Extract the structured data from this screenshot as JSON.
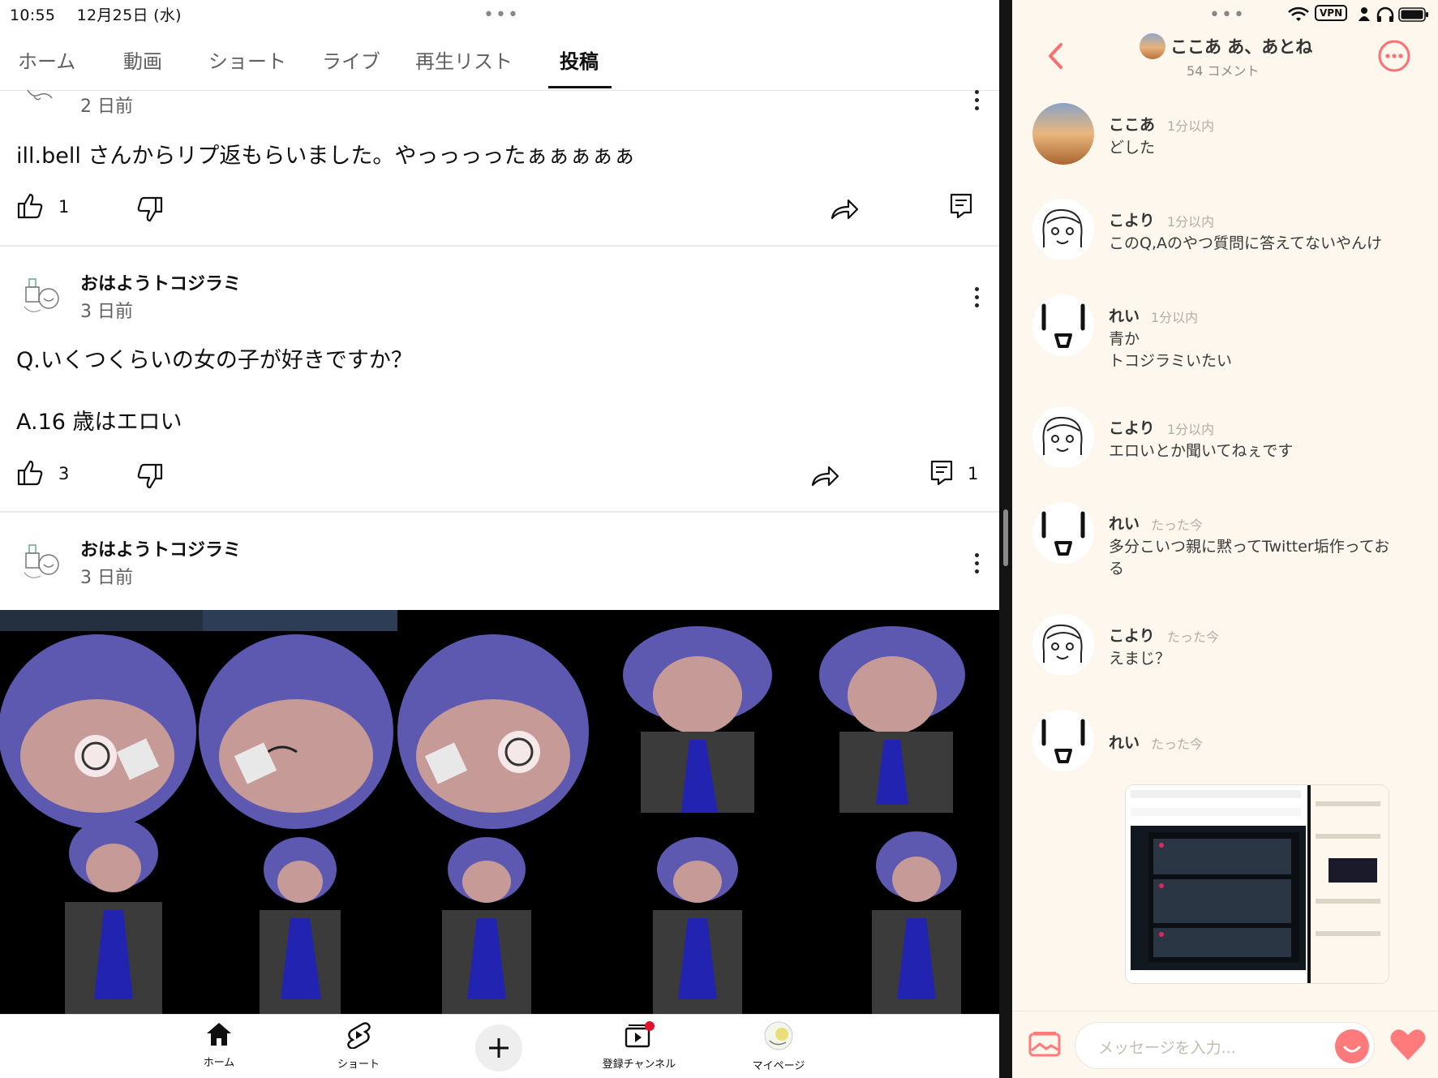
{
  "status_bar": {
    "time": "10:55",
    "date": "12月25日 (水)",
    "vpn": "VPN"
  },
  "youtube": {
    "tabs": [
      {
        "label": "ホーム"
      },
      {
        "label": "動画"
      },
      {
        "label": "ショート"
      },
      {
        "label": "ライブ"
      },
      {
        "label": "再生リスト"
      },
      {
        "label": "投稿",
        "active": true
      }
    ],
    "posts": [
      {
        "date": "2 日前",
        "text": "ill.bell さんからリプ返もらいました。やっっっったぁぁぁぁぁ",
        "likes": "1"
      },
      {
        "author": "おはようトコジラミ",
        "date": "3 日前",
        "text_lines": [
          "Q.いくつくらいの女の子が好きですか？",
          "A.16 歳はエロい"
        ],
        "likes": "3",
        "comments": "1"
      },
      {
        "author": "おはようトコジラミ",
        "date": "3 日前"
      }
    ],
    "bottom_nav": [
      {
        "label": "ホーム",
        "icon": "home-icon"
      },
      {
        "label": "ショート",
        "icon": "shorts-icon"
      },
      {
        "label": "",
        "icon": "plus-icon"
      },
      {
        "label": "登録チャンネル",
        "icon": "subscriptions-icon"
      },
      {
        "label": "マイページ",
        "icon": "avatar-icon"
      }
    ]
  },
  "chat": {
    "title": "ここあ あ、あとね",
    "subtitle": "54 コメント",
    "messages": [
      {
        "name": "ここあ",
        "time": "1分以内",
        "text": "どした",
        "avatar": "sunset-avatar"
      },
      {
        "name": "こより",
        "time": "1分以内",
        "text": "このQ,Aのやつ質問に答えてないやんけ",
        "avatar": "sketch-face-avatar"
      },
      {
        "name": "れい",
        "time": "1分以内",
        "text": "青か\nトコジラミいたい",
        "avatar": "simple-face-avatar"
      },
      {
        "name": "こより",
        "time": "1分以内",
        "text": "エロいとか聞いてねぇです",
        "avatar": "sketch-face-avatar"
      },
      {
        "name": "れい",
        "time": "たった今",
        "text": "多分こいつ親に黙ってTwitter垢作ってお\nる",
        "avatar": "simple-face-avatar"
      },
      {
        "name": "こより",
        "time": "たった今",
        "text": "えまじ？",
        "avatar": "sketch-face-avatar"
      },
      {
        "name": "れい",
        "time": "たった今",
        "text": "",
        "avatar": "simple-face-avatar"
      }
    ],
    "composer_placeholder": "メッセージを入力...",
    "colors": {
      "accent": "#ff7a7a",
      "background": "#fdf7ee"
    }
  }
}
